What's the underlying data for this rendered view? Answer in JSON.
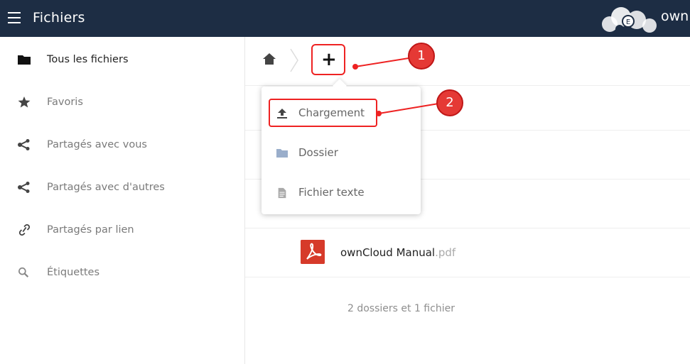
{
  "header": {
    "title": "Fichiers",
    "brand": "own",
    "background": "#1d2d44"
  },
  "sidebar": {
    "items": [
      {
        "label": "Tous les fichiers",
        "icon": "folder-icon",
        "active": true
      },
      {
        "label": "Favoris",
        "icon": "star-icon"
      },
      {
        "label": "Partagés avec vous",
        "icon": "share-icon"
      },
      {
        "label": "Partagés avec d'autres",
        "icon": "share-icon"
      },
      {
        "label": "Partagés par lien",
        "icon": "link-icon"
      },
      {
        "label": "Étiquettes",
        "icon": "search-icon"
      }
    ]
  },
  "toolbar": {
    "new_label": "+"
  },
  "new_menu": {
    "items": [
      {
        "label": "Chargement",
        "icon": "upload-icon"
      },
      {
        "label": "Dossier",
        "icon": "folder-icon"
      },
      {
        "label": "Fichier texte",
        "icon": "text-file-icon"
      }
    ]
  },
  "files": [
    {
      "name": "ownCloud Manual",
      "ext": ".pdf",
      "icon": "pdf-icon"
    }
  ],
  "summary": "2 dossiers et 1 fichier",
  "callouts": {
    "one": "1",
    "two": "2",
    "color": "#e53935"
  }
}
